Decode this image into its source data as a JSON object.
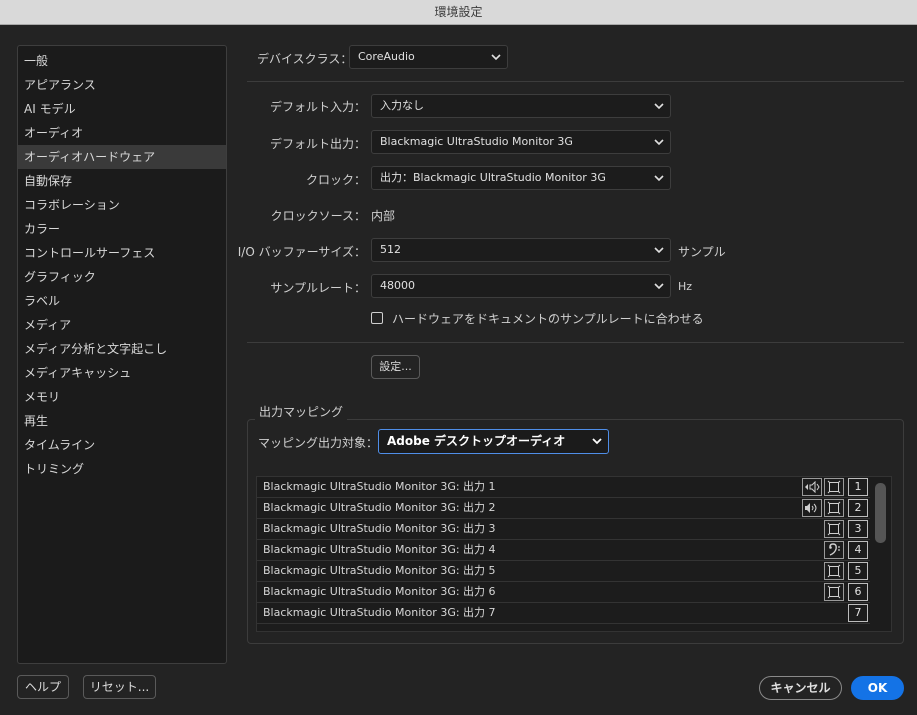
{
  "window": {
    "title": "環境設定"
  },
  "sidebar": {
    "items": [
      {
        "label": "一般",
        "selected": false
      },
      {
        "label": "アピアランス",
        "selected": false
      },
      {
        "label": "AI モデル",
        "selected": false
      },
      {
        "label": "オーディオ",
        "selected": false
      },
      {
        "label": "オーディオハードウェア",
        "selected": true
      },
      {
        "label": "自動保存",
        "selected": false
      },
      {
        "label": "コラボレーション",
        "selected": false
      },
      {
        "label": "カラー",
        "selected": false
      },
      {
        "label": "コントロールサーフェス",
        "selected": false
      },
      {
        "label": "グラフィック",
        "selected": false
      },
      {
        "label": "ラベル",
        "selected": false
      },
      {
        "label": "メディア",
        "selected": false
      },
      {
        "label": "メディア分析と文字起こし",
        "selected": false
      },
      {
        "label": "メディアキャッシュ",
        "selected": false
      },
      {
        "label": "メモリ",
        "selected": false
      },
      {
        "label": "再生",
        "selected": false
      },
      {
        "label": "タイムライン",
        "selected": false
      },
      {
        "label": "トリミング",
        "selected": false
      }
    ]
  },
  "device": {
    "class_label": "デバイスクラス：",
    "class_value": "CoreAudio",
    "default_input_label": "デフォルト入力：",
    "default_input_value": "入力なし",
    "default_output_label": "デフォルト出力：",
    "default_output_value": "Blackmagic UltraStudio Monitor 3G",
    "clock_label": "クロック：",
    "clock_value": "出力：Blackmagic UltraStudio Monitor 3G",
    "clock_source_label": "クロックソース：",
    "clock_source_value": "内部",
    "buffer_label": "I/O バッファーサイズ：",
    "buffer_value": "512",
    "buffer_unit": "サンプル",
    "samplerate_label": "サンプルレート：",
    "samplerate_value": "48000",
    "samplerate_unit": "Hz",
    "match_checkbox_label": "ハードウェアをドキュメントのサンプルレートに合わせる",
    "match_checked": false,
    "settings_button": "設定..."
  },
  "output_mapping": {
    "group_label": "出力マッピング",
    "target_label": "マッピング出力対象：",
    "target_value": "Adobe デスクトップオーディオ",
    "rows": [
      {
        "label": "Blackmagic UltraStudio Monitor 3G: 出力 1",
        "number": "1",
        "icons": [
          "speaker-left-icon",
          "speaker-box-icon"
        ]
      },
      {
        "label": "Blackmagic UltraStudio Monitor 3G: 出力 2",
        "number": "2",
        "icons": [
          "speaker-right-icon",
          "speaker-box-icon"
        ]
      },
      {
        "label": "Blackmagic UltraStudio Monitor 3G: 出力 3",
        "number": "3",
        "icons": [
          "speaker-box-icon"
        ]
      },
      {
        "label": "Blackmagic UltraStudio Monitor 3G: 出力 4",
        "number": "4",
        "icons": [
          "bass-clef-icon"
        ]
      },
      {
        "label": "Blackmagic UltraStudio Monitor 3G: 出力 5",
        "number": "5",
        "icons": [
          "speaker-box-icon"
        ]
      },
      {
        "label": "Blackmagic UltraStudio Monitor 3G: 出力 6",
        "number": "6",
        "icons": [
          "speaker-box-icon"
        ]
      },
      {
        "label": "Blackmagic UltraStudio Monitor 3G: 出力 7",
        "number": "7",
        "icons": []
      }
    ]
  },
  "footer": {
    "help": "ヘルプ",
    "reset": "リセット...",
    "cancel": "キャンセル",
    "ok": "OK"
  },
  "colors": {
    "accent": "#1473e6",
    "focus": "#4f8ee8"
  }
}
